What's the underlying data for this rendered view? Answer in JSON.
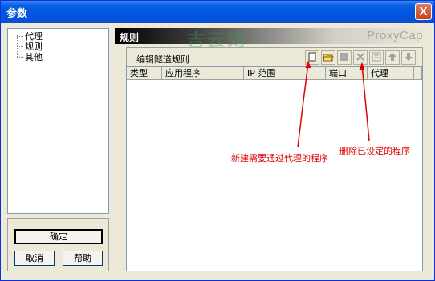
{
  "window": {
    "title": "参数",
    "close_symbol": "X"
  },
  "tree": {
    "items": [
      "代理",
      "规则",
      "其他"
    ]
  },
  "buttons": {
    "ok": "确定",
    "cancel": "取消",
    "help": "帮助"
  },
  "header": {
    "title": "规则",
    "brand": "ProxyCap",
    "watermark": "吉云网"
  },
  "toolbar": {
    "label": "编辑隧道规则",
    "icons": [
      "new-icon",
      "open-folder-icon",
      "stop-icon",
      "delete-icon",
      "properties-icon",
      "arrow-up-icon",
      "arrow-down-icon"
    ]
  },
  "table": {
    "columns": [
      "类型",
      "应用程序",
      "IP 范围",
      "端口",
      "代理"
    ]
  },
  "annotations": {
    "new_rule": "新建需要通过代理的程序",
    "delete_rule": "删除已设定的程序"
  },
  "colors": {
    "annotation": "#e00000",
    "titlebar": "#0054e3"
  }
}
